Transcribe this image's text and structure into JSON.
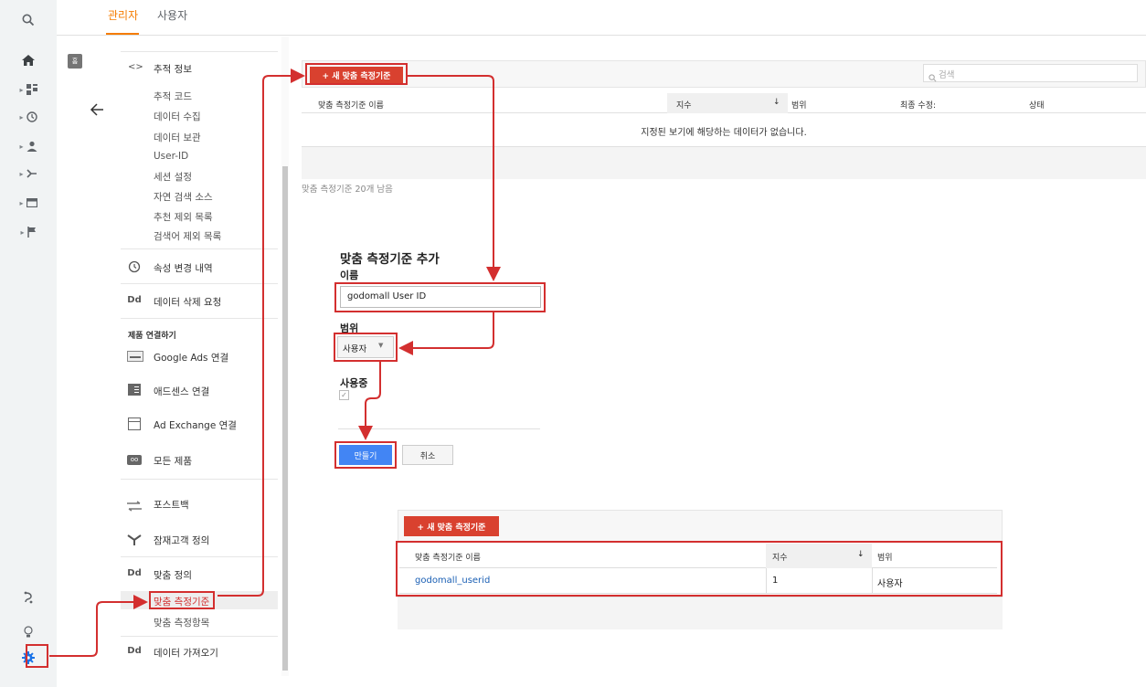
{
  "tabs": {
    "admin": "관리자",
    "user": "사용자"
  },
  "rail": {
    "items": [
      "search-icon",
      "home-icon",
      "dashboard-icon",
      "clock-icon",
      "person-icon",
      "acquisition-icon",
      "display-icon",
      "flag-icon",
      "attribution-icon",
      "lightbulb-icon",
      "gear-icon"
    ],
    "home_badge": "홈"
  },
  "nav": {
    "tracking_info": "추적 정보",
    "sub_items": [
      "추적 코드",
      "데이터 수집",
      "데이터 보관",
      "User-ID",
      "세션 설정",
      "자연 검색 소스",
      "추천 제외 목록",
      "검색어 제외 목록"
    ],
    "property_change_history": "속성 변경 내역",
    "data_deletion_request": "데이터 삭제 요청",
    "product_linking_header": "제품 연결하기",
    "google_ads": "Google Ads 연결",
    "adsense": "애드센스 연결",
    "ad_exchange": "Ad Exchange 연결",
    "all_products": "모든 제품",
    "postbacks": "포스트백",
    "audience_definitions": "잠재고객 정의",
    "custom_definitions": "맞춤 정의",
    "custom_metrics": "맞춤 측정기준",
    "custom_items": "맞춤 측정항목",
    "data_import": "데이터 가져오기",
    "dd_label": "Dd"
  },
  "top_table": {
    "new_button": "+ 새 맞춤 측정기준",
    "search_placeholder": "검색",
    "columns": [
      "맞춤 측정기준 이름",
      "지수",
      "범위",
      "최종 수정:",
      "상태"
    ],
    "empty_message": "지정된 보기에 해당하는 데이터가 없습니다.",
    "remaining": "맞춤 측정기준 20개 남음"
  },
  "form": {
    "title": "맞춤 측정기준 추가",
    "name_label": "이름",
    "name_value": "godomall User ID",
    "scope_label": "범위",
    "scope_value": "사용자",
    "active_label": "사용중",
    "create_button": "만들기",
    "cancel_button": "취소"
  },
  "bottom_table": {
    "new_button": "+ 새 맞춤 측정기준",
    "columns": [
      "맞춤 측정기준 이름",
      "지수",
      "범위"
    ],
    "rows": [
      {
        "name": "godomall_userid",
        "index": "1",
        "scope": "사용자"
      }
    ]
  },
  "colors": {
    "accent": "#f57c00",
    "red": "#d9412f",
    "blue": "#4285f4",
    "link": "#1a5fb4"
  }
}
